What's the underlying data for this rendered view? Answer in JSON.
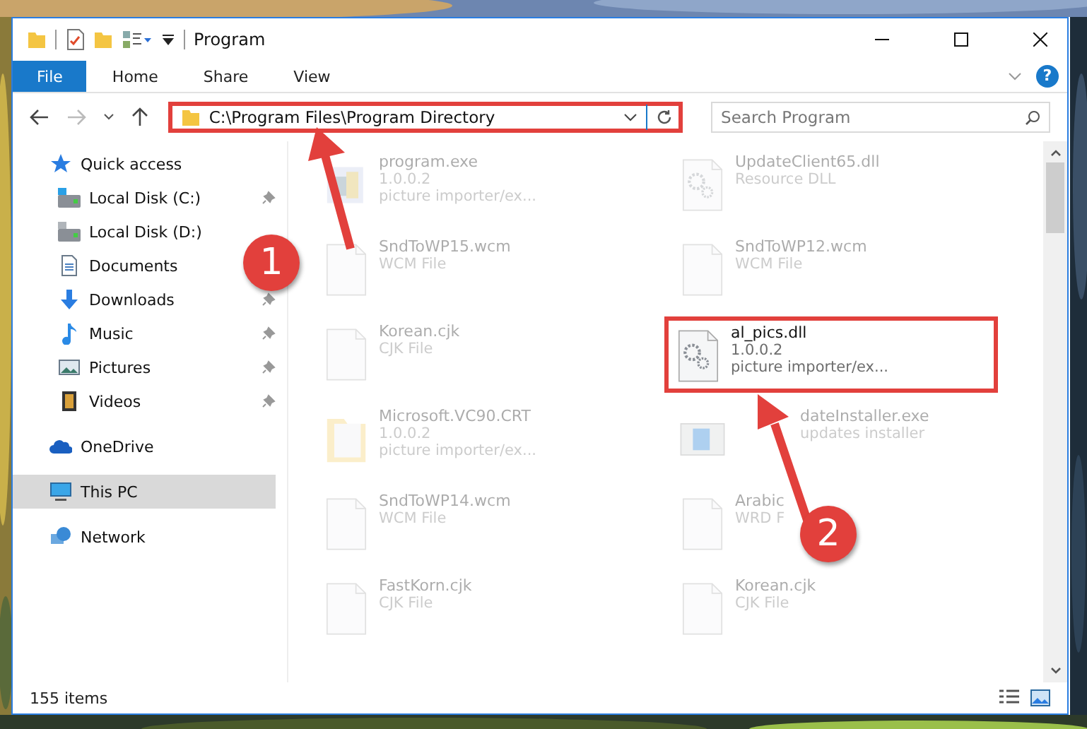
{
  "window": {
    "title": "Program"
  },
  "ribbon_tabs": [
    {
      "label": "File",
      "selected": true
    },
    {
      "label": "Home",
      "selected": false
    },
    {
      "label": "Share",
      "selected": false
    },
    {
      "label": "View",
      "selected": false
    }
  ],
  "help_label": "?",
  "address": {
    "path": "C:\\Program Files\\Program Directory",
    "highlighted": true
  },
  "search": {
    "placeholder": "Search Program"
  },
  "nav": [
    {
      "label": "Quick access",
      "kind": "star",
      "selected": false,
      "children": [
        {
          "label": "Local Disk (C:)",
          "kind": "disk-c",
          "pinned": true,
          "selected": false
        },
        {
          "label": "Local Disk (D:)",
          "kind": "disk",
          "pinned": false,
          "selected": false
        },
        {
          "label": "Documents",
          "kind": "docs",
          "pinned": false,
          "selected": false
        },
        {
          "label": "Downloads",
          "kind": "download",
          "pinned": true,
          "selected": false
        },
        {
          "label": "Music",
          "kind": "music",
          "pinned": true,
          "selected": false
        },
        {
          "label": "Pictures",
          "kind": "pictures",
          "pinned": true,
          "selected": false
        },
        {
          "label": "Videos",
          "kind": "videos",
          "pinned": true,
          "selected": false
        }
      ]
    },
    {
      "label": "OneDrive",
      "kind": "cloud",
      "selected": false
    },
    {
      "label": "This PC",
      "kind": "pc",
      "selected": true
    },
    {
      "label": "Network",
      "kind": "network",
      "selected": false
    }
  ],
  "files": [
    {
      "name": "program.exe",
      "kind": "app",
      "lines": [
        "1.0.0.2",
        "picture importer/ex..."
      ],
      "dimmed": true,
      "highlighted": false
    },
    {
      "name": "UpdateClient65.dll",
      "kind": "gear",
      "lines": [
        "Resource DLL"
      ],
      "dimmed": true,
      "highlighted": false
    },
    {
      "name": "SndToWP15.wcm",
      "kind": "blank",
      "lines": [
        "WCM File"
      ],
      "dimmed": true,
      "highlighted": false
    },
    {
      "name": "SndToWP12.wcm",
      "kind": "blank",
      "lines": [
        "WCM File"
      ],
      "dimmed": true,
      "highlighted": false
    },
    {
      "name": "Korean.cjk",
      "kind": "blank",
      "lines": [
        "CJK File"
      ],
      "dimmed": true,
      "highlighted": false
    },
    {
      "name": "al_pics.dll",
      "kind": "gear",
      "lines": [
        "1.0.0.2",
        "picture importer/ex..."
      ],
      "dimmed": false,
      "highlighted": true
    },
    {
      "name": "Microsoft.VC90.CRT",
      "kind": "folder",
      "lines": [
        "1.0.0.2",
        "picture importer/ex..."
      ],
      "dimmed": true,
      "highlighted": false
    },
    {
      "name": "dateInstaller.exe",
      "kind": "installer",
      "lines": [
        "updates installer"
      ],
      "dimmed": true,
      "highlighted": false
    },
    {
      "name": "SndToWP14.wcm",
      "kind": "blank",
      "lines": [
        "WCM File"
      ],
      "dimmed": true,
      "highlighted": false
    },
    {
      "name": "Arabic",
      "kind": "blank",
      "lines": [
        "WRD F"
      ],
      "dimmed": true,
      "highlighted": false
    },
    {
      "name": "FastKorn.cjk",
      "kind": "blank",
      "lines": [
        "CJK File"
      ],
      "dimmed": true,
      "highlighted": false
    },
    {
      "name": "Korean.cjk",
      "kind": "blank",
      "lines": [
        "CJK File"
      ],
      "dimmed": true,
      "highlighted": false
    }
  ],
  "status_bar": {
    "count": "155 items"
  },
  "annotations": [
    {
      "number": "1"
    },
    {
      "number": "2"
    }
  ]
}
